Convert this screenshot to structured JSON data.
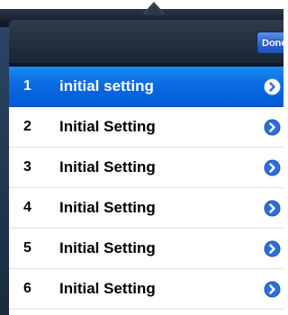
{
  "popover": {
    "done_label": "Done"
  },
  "rows": [
    {
      "number": "1",
      "label": "initial setting",
      "selected": true
    },
    {
      "number": "2",
      "label": "Initial Setting",
      "selected": false
    },
    {
      "number": "3",
      "label": "Initial Setting",
      "selected": false
    },
    {
      "number": "4",
      "label": "Initial Setting",
      "selected": false
    },
    {
      "number": "5",
      "label": "Initial Setting",
      "selected": false
    },
    {
      "number": "6",
      "label": "Initial Setting",
      "selected": false
    }
  ],
  "icons": {
    "disclosure": "detail-disclosure-icon"
  },
  "colors": {
    "selection": "#0a6ae1",
    "disclosure": "#2d6fd9",
    "done_button": "#2c63d2",
    "frame": "#0f1824"
  }
}
